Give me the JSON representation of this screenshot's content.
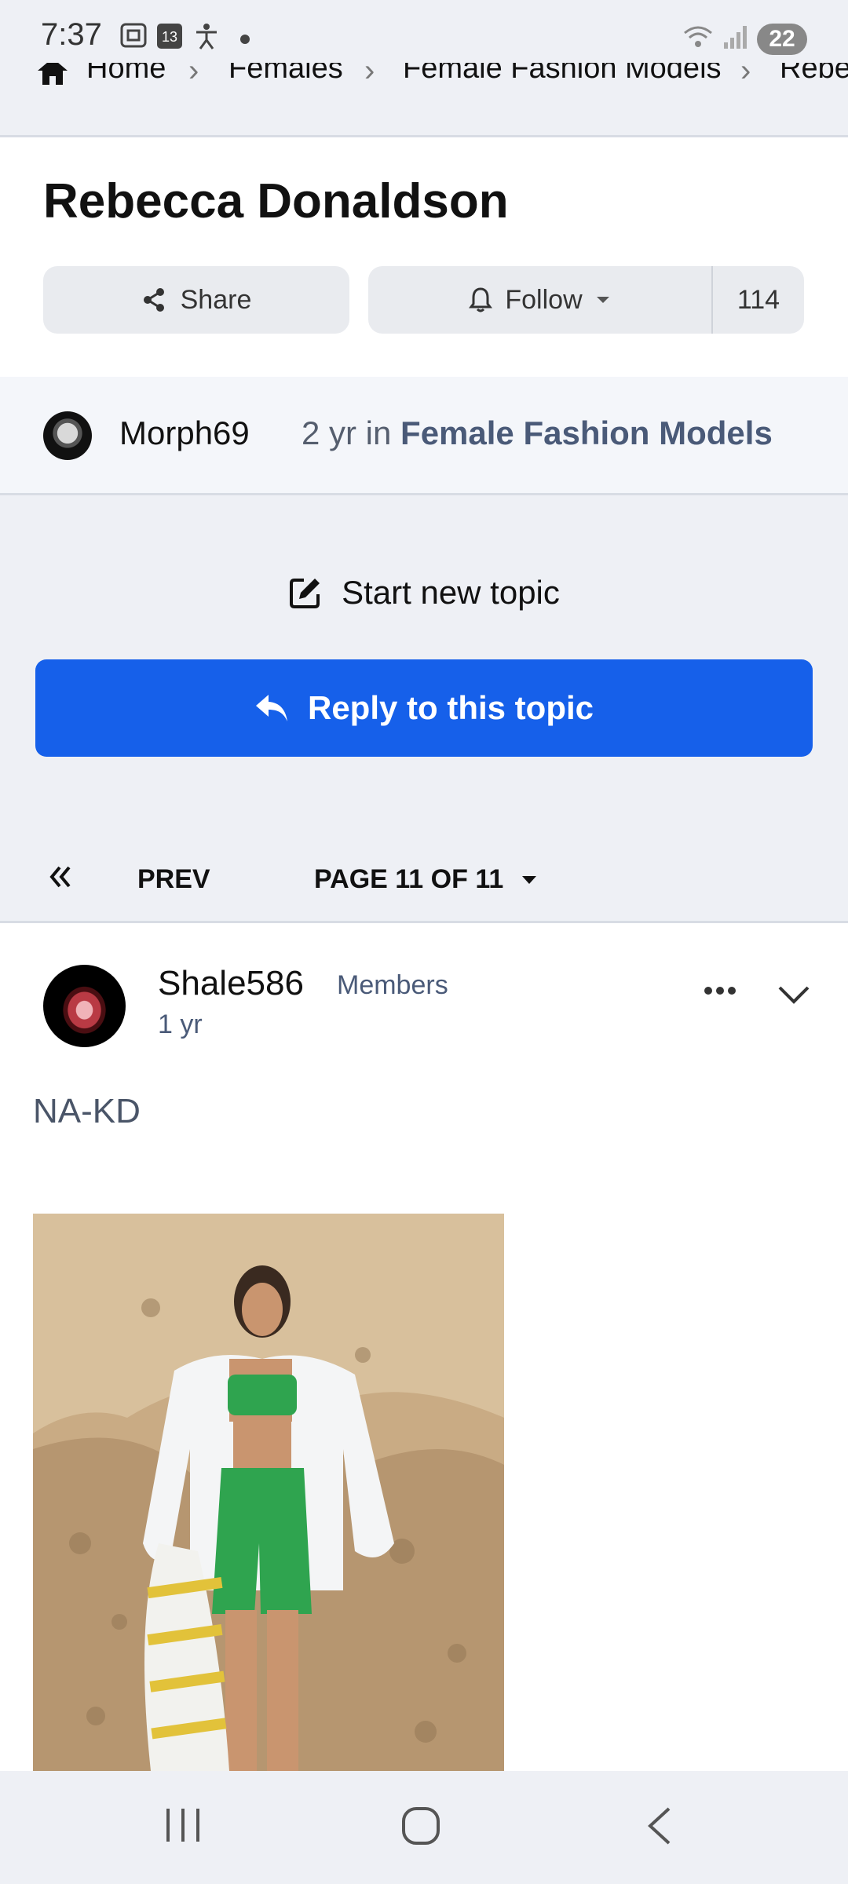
{
  "status": {
    "time": "7:37",
    "calendar_day": "13",
    "battery": "22"
  },
  "breadcrumb": [
    "Home",
    "Females",
    "Female Fashion Models",
    "Rebe"
  ],
  "topic": {
    "title": "Rebecca Donaldson",
    "share_label": "Share",
    "follow_label": "Follow",
    "follow_count": "114"
  },
  "author_bar": {
    "author": "Morph69",
    "time_prefix": "2 yr in",
    "forum": "Female Fashion Models"
  },
  "actions": {
    "start_topic": "Start new topic",
    "reply": "Reply to this topic"
  },
  "pager": {
    "prev": "PREV",
    "pages": "PAGE 11 OF 11"
  },
  "post": {
    "author": "Shale586",
    "group": "Members",
    "age": "1 yr",
    "content": "NA-KD"
  },
  "icons": {
    "home": "home-icon",
    "share": "share-icon",
    "bell": "bell-icon",
    "edit": "edit-icon",
    "reply": "reply-icon",
    "first": "double-chevron-left-icon",
    "caret": "caret-down-icon",
    "more": "ellipsis-icon",
    "collapse": "chevron-down-icon"
  },
  "colors": {
    "accent": "#1660ea",
    "page_bg": "#eef0f5",
    "muted": "#4a5a78"
  }
}
